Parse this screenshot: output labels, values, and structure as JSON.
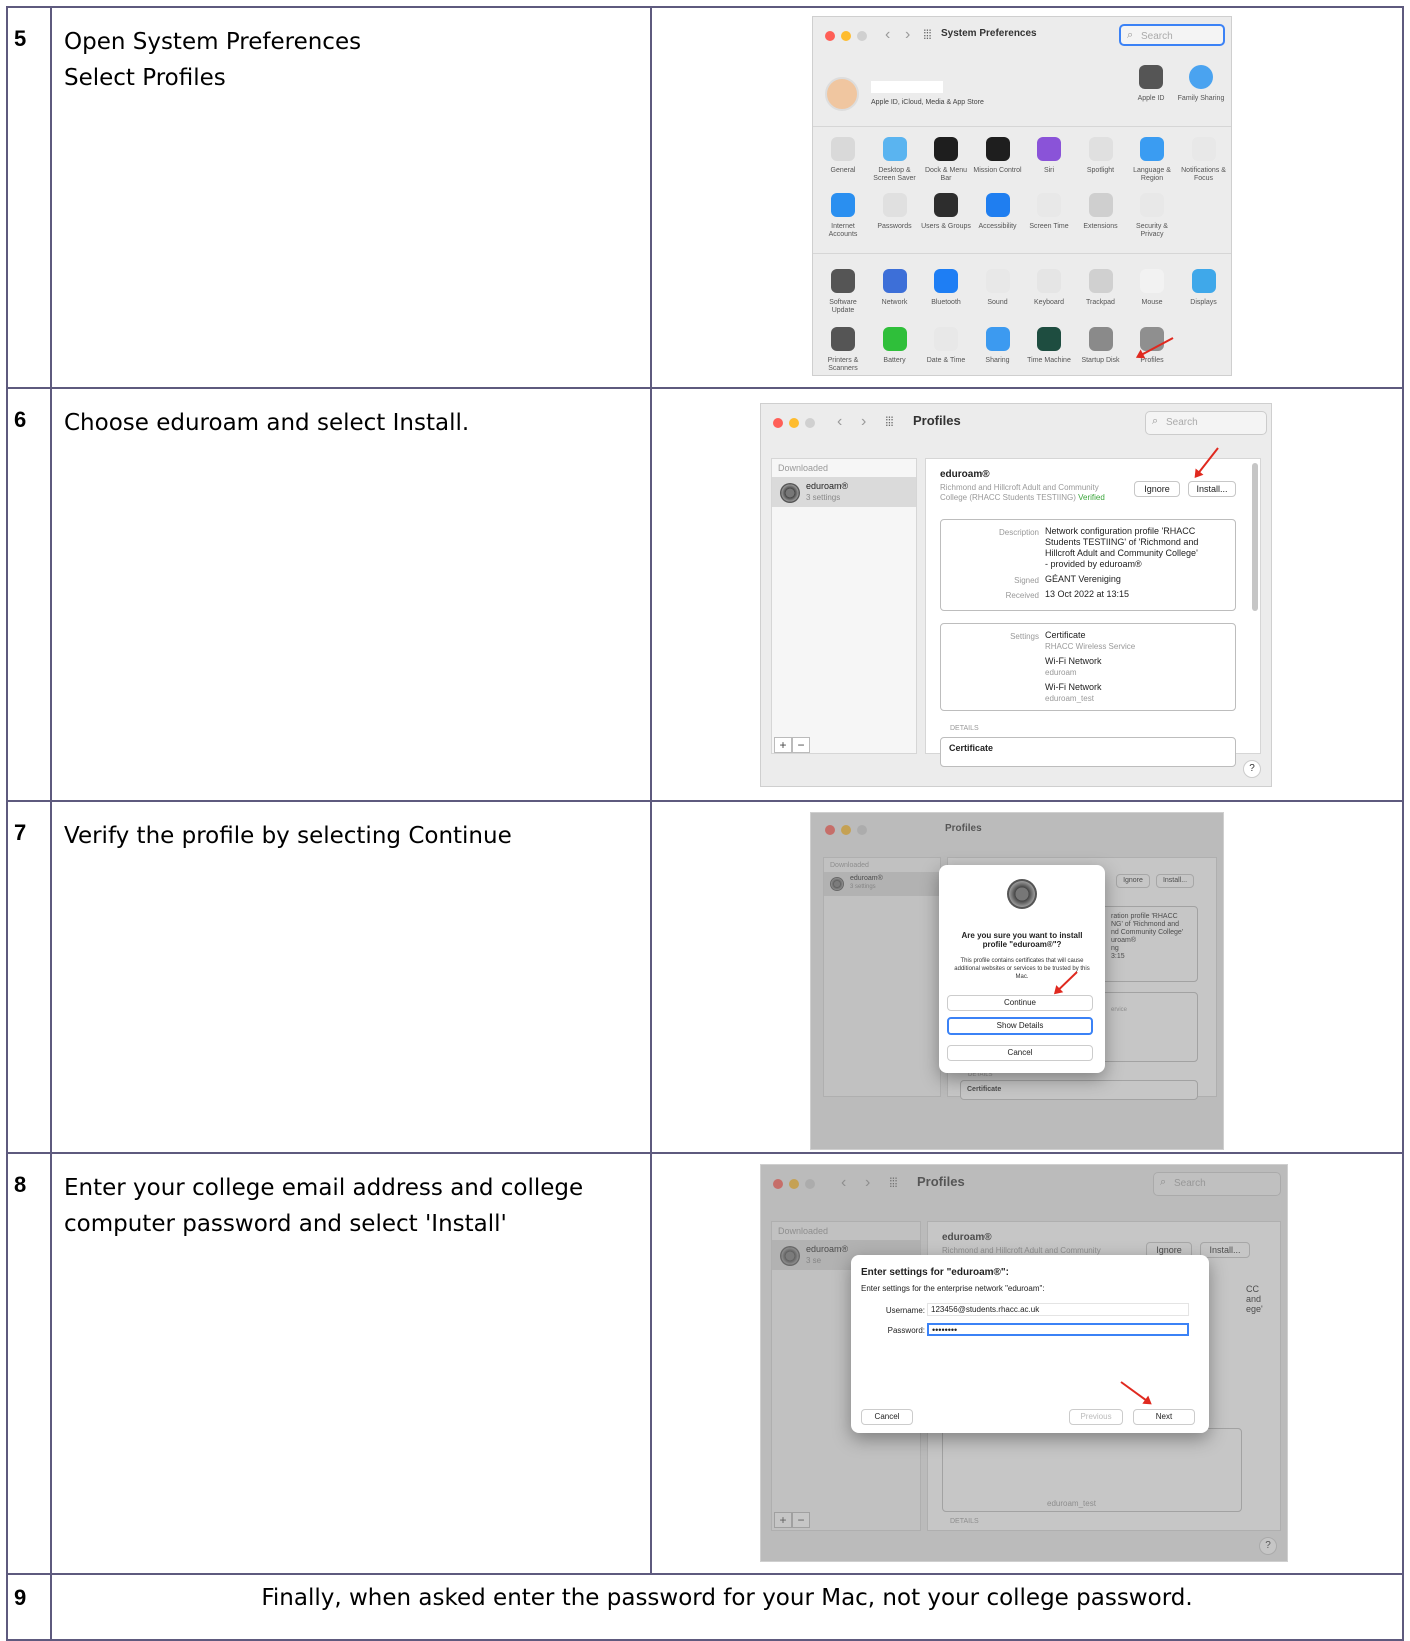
{
  "steps": [
    {
      "number": "5",
      "line1": "Open System Preferences",
      "line2": "Select Profiles"
    },
    {
      "number": "6",
      "line1": "Choose eduroam and select Install."
    },
    {
      "number": "7",
      "line1": "Verify the profile by selecting Continue"
    },
    {
      "number": "8",
      "line1": "Enter your college email address and college",
      "line2": "computer password and select 'Install'"
    },
    {
      "number": "9",
      "line1": "Finally, when asked enter the password for your Mac, not your college password."
    }
  ],
  "sysprefs": {
    "title": "System Preferences",
    "search": "Search",
    "apple_id_sub": "Apple ID, iCloud, Media & App Store",
    "apple_id": "Apple ID",
    "family": "Family Sharing",
    "row1": [
      "General",
      "Desktop & Screen Saver",
      "Dock & Menu Bar",
      "Mission Control",
      "Siri",
      "Spotlight",
      "Language & Region",
      "Notifications & Focus"
    ],
    "row2": [
      "Internet Accounts",
      "Passwords",
      "Users & Groups",
      "Accessibility",
      "Screen Time",
      "Extensions",
      "Security & Privacy"
    ],
    "row3": [
      "Software Update",
      "Network",
      "Bluetooth",
      "Sound",
      "Keyboard",
      "Trackpad",
      "Mouse",
      "Displays"
    ],
    "row4": [
      "Printers & Scanners",
      "Battery",
      "Date & Time",
      "Sharing",
      "Time Machine",
      "Startup Disk",
      "Profiles"
    ],
    "colors": {
      "row1": [
        "#d9d9d9",
        "#5ab4f0",
        "#1e1e1e",
        "#1e1e1e",
        "#8a53d8",
        "#e0e0e0",
        "#3a9cf2",
        "#e8e8e8"
      ],
      "row2": [
        "#2a8ff0",
        "#e0e0e0",
        "#2d2d2d",
        "#1f7ef0",
        "#e8e8e8",
        "#cfcfcf",
        "#e8e8e8"
      ],
      "row3": [
        "#555555",
        "#3d6fd8",
        "#1e7ef4",
        "#e8e8e8",
        "#e5e5e5",
        "#d0d0d0",
        "#f2f2f2",
        "#3fa8ea"
      ],
      "row4": [
        "#555555",
        "#2fbf3a",
        "#e8e8e8",
        "#3c9af0",
        "#1e4d40",
        "#8a8a8a",
        "#8f8f8f"
      ]
    }
  },
  "profiles": {
    "title": "Profiles",
    "search": "Search",
    "downloaded": "Downloaded",
    "item_name": "eduroam®",
    "item_sub": "3 settings",
    "header_name": "eduroam®",
    "header_org": "Richmond and Hillcroft Adult and Community",
    "header_org2": "College (RHACC Students TESTIING)",
    "verified": "Verified",
    "ignore": "Ignore",
    "install": "Install...",
    "description_label": "Description",
    "description_value": [
      "Network configuration profile 'RHACC",
      "Students TESTIING' of 'Richmond and",
      "Hillcroft Adult and Community College'",
      "- provided by eduroam®"
    ],
    "signed_label": "Signed",
    "signed_value": "GÉANT Vereniging",
    "received_label": "Received",
    "received_value": "13 Oct 2022 at 13:15",
    "settings_label": "Settings",
    "settings": [
      {
        "name": "Certificate",
        "sub": "RHACC Wireless Service"
      },
      {
        "name": "Wi-Fi Network",
        "sub": "eduroam"
      },
      {
        "name": "Wi-Fi Network",
        "sub": "eduroam_test"
      }
    ],
    "details": "DETAILS",
    "certificate": "Certificate",
    "plus": "+",
    "minus": "−",
    "help": "?"
  },
  "confirm": {
    "title": "Are you sure you want to install profile \"eduroam®\"?",
    "text": "This profile contains certificates that will cause additional websites or services to be trusted by this Mac.",
    "continue": "Continue",
    "show_details": "Show Details",
    "cancel": "Cancel",
    "bg_desc": [
      "ration profile 'RHACC",
      "NG' of 'Richmond and",
      "nd Community College'",
      "uroam®",
      "ng",
      "3:15"
    ],
    "bg_service": "ervice"
  },
  "enter": {
    "title": "Enter settings for \"eduroam®\":",
    "subtitle": "Enter settings for the enterprise network \"eduroam\":",
    "username_label": "Username:",
    "username_value": "123456@students.rhacc.ac.uk",
    "password_label": "Password:",
    "password_value": "••••••••",
    "cancel": "Cancel",
    "previous": "Previous",
    "next": "Next",
    "bg_org": "Richmond and Hillcroft Adult and Community",
    "bg_right": [
      "CC",
      "and",
      "ege'"
    ],
    "bg_sub": "3 se",
    "bg_test": "eduroam_test"
  }
}
